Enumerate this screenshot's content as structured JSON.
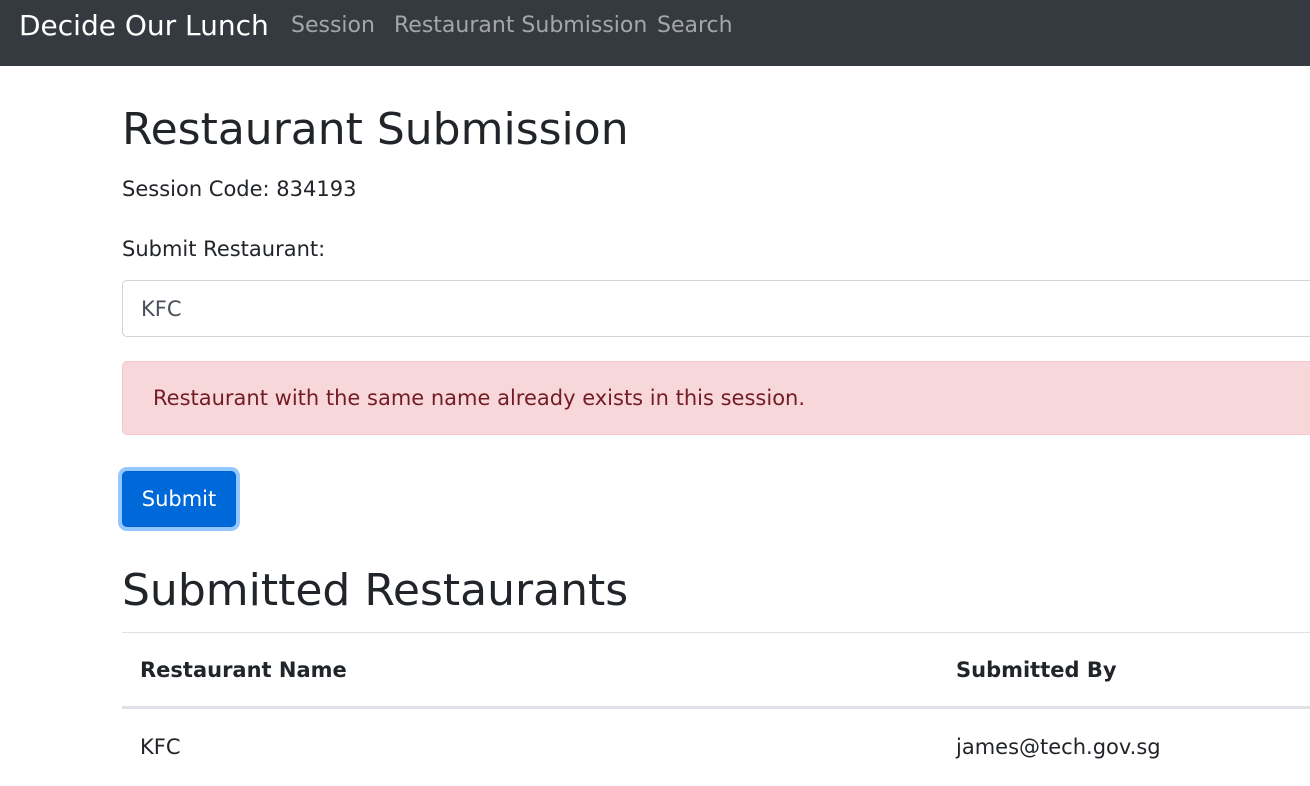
{
  "navbar": {
    "brand": "Decide Our Lunch",
    "links": [
      "Session",
      "Restaurant Submission",
      "Search"
    ]
  },
  "page": {
    "title": "Restaurant Submission",
    "session_code": "Session Code: 834193"
  },
  "form": {
    "label": "Submit Restaurant:",
    "input_value": "KFC",
    "error_message": "Restaurant with the same name already exists in this session.",
    "submit_label": "Submit"
  },
  "submitted": {
    "title": "Submitted Restaurants",
    "columns": [
      "Restaurant Name",
      "Submitted By"
    ],
    "rows": [
      {
        "name": "KFC",
        "submitted_by": "james@tech.gov.sg"
      }
    ]
  },
  "colors": {
    "navbar_bg": "#343a40",
    "primary": "#0069d9",
    "alert_bg": "#f8d7da",
    "alert_text": "#721c24"
  }
}
